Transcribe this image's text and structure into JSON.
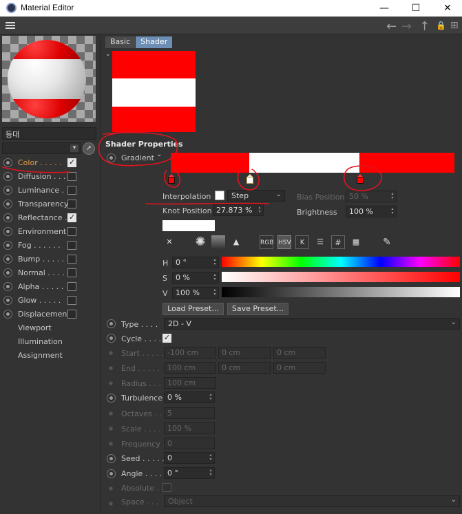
{
  "window": {
    "title": "Material Editor",
    "minimize": "—",
    "maximize": "☐",
    "close": "✕"
  },
  "nav": {
    "back": "←",
    "forward": "→",
    "up": "↑",
    "lock": "🔒",
    "new": "⊞"
  },
  "material": {
    "name": "등대",
    "channels": [
      {
        "label": "Color . . . . .",
        "checked": true,
        "active": true
      },
      {
        "label": "Diffusion . . .",
        "checked": false
      },
      {
        "label": "Luminance . .",
        "checked": false
      },
      {
        "label": "Transparency",
        "checked": false
      },
      {
        "label": "Reflectance .",
        "checked": true
      },
      {
        "label": "Environment",
        "checked": false
      },
      {
        "label": "Fog . . . . . .",
        "checked": false
      },
      {
        "label": "Bump . . . . .",
        "checked": false
      },
      {
        "label": "Normal . . . .",
        "checked": false
      },
      {
        "label": "Alpha . . . . .",
        "checked": false
      },
      {
        "label": "Glow . . . . .",
        "checked": false
      },
      {
        "label": "Displacement",
        "checked": false
      }
    ],
    "extra_items": [
      "Viewport",
      "Illumination",
      "Assignment"
    ]
  },
  "tabs": [
    "Basic",
    "Shader"
  ],
  "shader": {
    "section_title": "Shader Properties",
    "gradient_label": "Gradient",
    "interpolation_label": "Interpolation",
    "interpolation_value": "Step",
    "knot_position_label": "Knot Position",
    "knot_position_value": "27.873 %",
    "bias_position_label": "Bias Position",
    "bias_position_value": "50 %",
    "brightness_label": "Brightness",
    "brightness_value": "100 %",
    "picker_modes": [
      "RGB",
      "HSV",
      "K",
      "#"
    ],
    "h_label": "H",
    "h_value": "0 °",
    "s_label": "S",
    "s_value": "0 %",
    "v_label": "V",
    "v_value": "100 %",
    "load_preset": "Load Preset...",
    "save_preset": "Save Preset...",
    "colors": {
      "red": "#ff0000",
      "white": "#ffffff"
    }
  },
  "params": {
    "type_label": "Type . . . .",
    "type_value": "2D - V",
    "cycle_label": "Cycle . . . .",
    "cycle_checked": true,
    "start_label": "Start . . . . .",
    "start_values": [
      "-100 cm",
      "0 cm",
      "0 cm"
    ],
    "end_label": "End . . . . .",
    "end_values": [
      "100 cm",
      "0 cm",
      "0 cm"
    ],
    "radius_label": "Radius . . . .",
    "radius_value": "100 cm",
    "turbulence_label": "Turbulence",
    "turbulence_value": "0 %",
    "octaves_label": "Octaves . . .",
    "octaves_value": "5",
    "scale_label": "Scale . . . . .",
    "scale_value": "100 %",
    "frequency_label": "Frequency . .",
    "frequency_value": "0",
    "seed_label": "Seed . . . . .",
    "seed_value": "0",
    "angle_label": "Angle . . . .",
    "angle_value": "0 °",
    "absolute_label": "Absolute . . .",
    "space_label": "Space . . . .",
    "space_value": "Object"
  }
}
